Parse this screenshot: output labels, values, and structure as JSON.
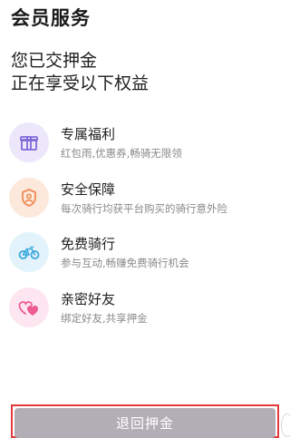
{
  "header": {
    "title": "会员服务"
  },
  "headline": {
    "line1": "您已交押金",
    "line2": "正在享受以下权益"
  },
  "benefits": [
    {
      "title": "专属福利",
      "desc": "红包雨,优惠券,畅骑无限领",
      "icon": "gift-icon",
      "icon_bg": "#ece7fb",
      "icon_color": "#7d6ad8"
    },
    {
      "title": "安全保障",
      "desc": "每次骑行均获平台购买的骑行意外险",
      "icon": "shield-user-icon",
      "icon_bg": "#fde9dc",
      "icon_color": "#ee8a55"
    },
    {
      "title": "免费骑行",
      "desc": "参与互动,畅赚免费骑行机会",
      "icon": "bicycle-icon",
      "icon_bg": "#e2f3fb",
      "icon_color": "#3ba7dd"
    },
    {
      "title": "亲密好友",
      "desc": "绑定好友,共享押金",
      "icon": "hearts-icon",
      "icon_bg": "#fde6ef",
      "icon_color": "#ee5c90"
    }
  ],
  "actions": {
    "return_deposit": "退回押金"
  }
}
